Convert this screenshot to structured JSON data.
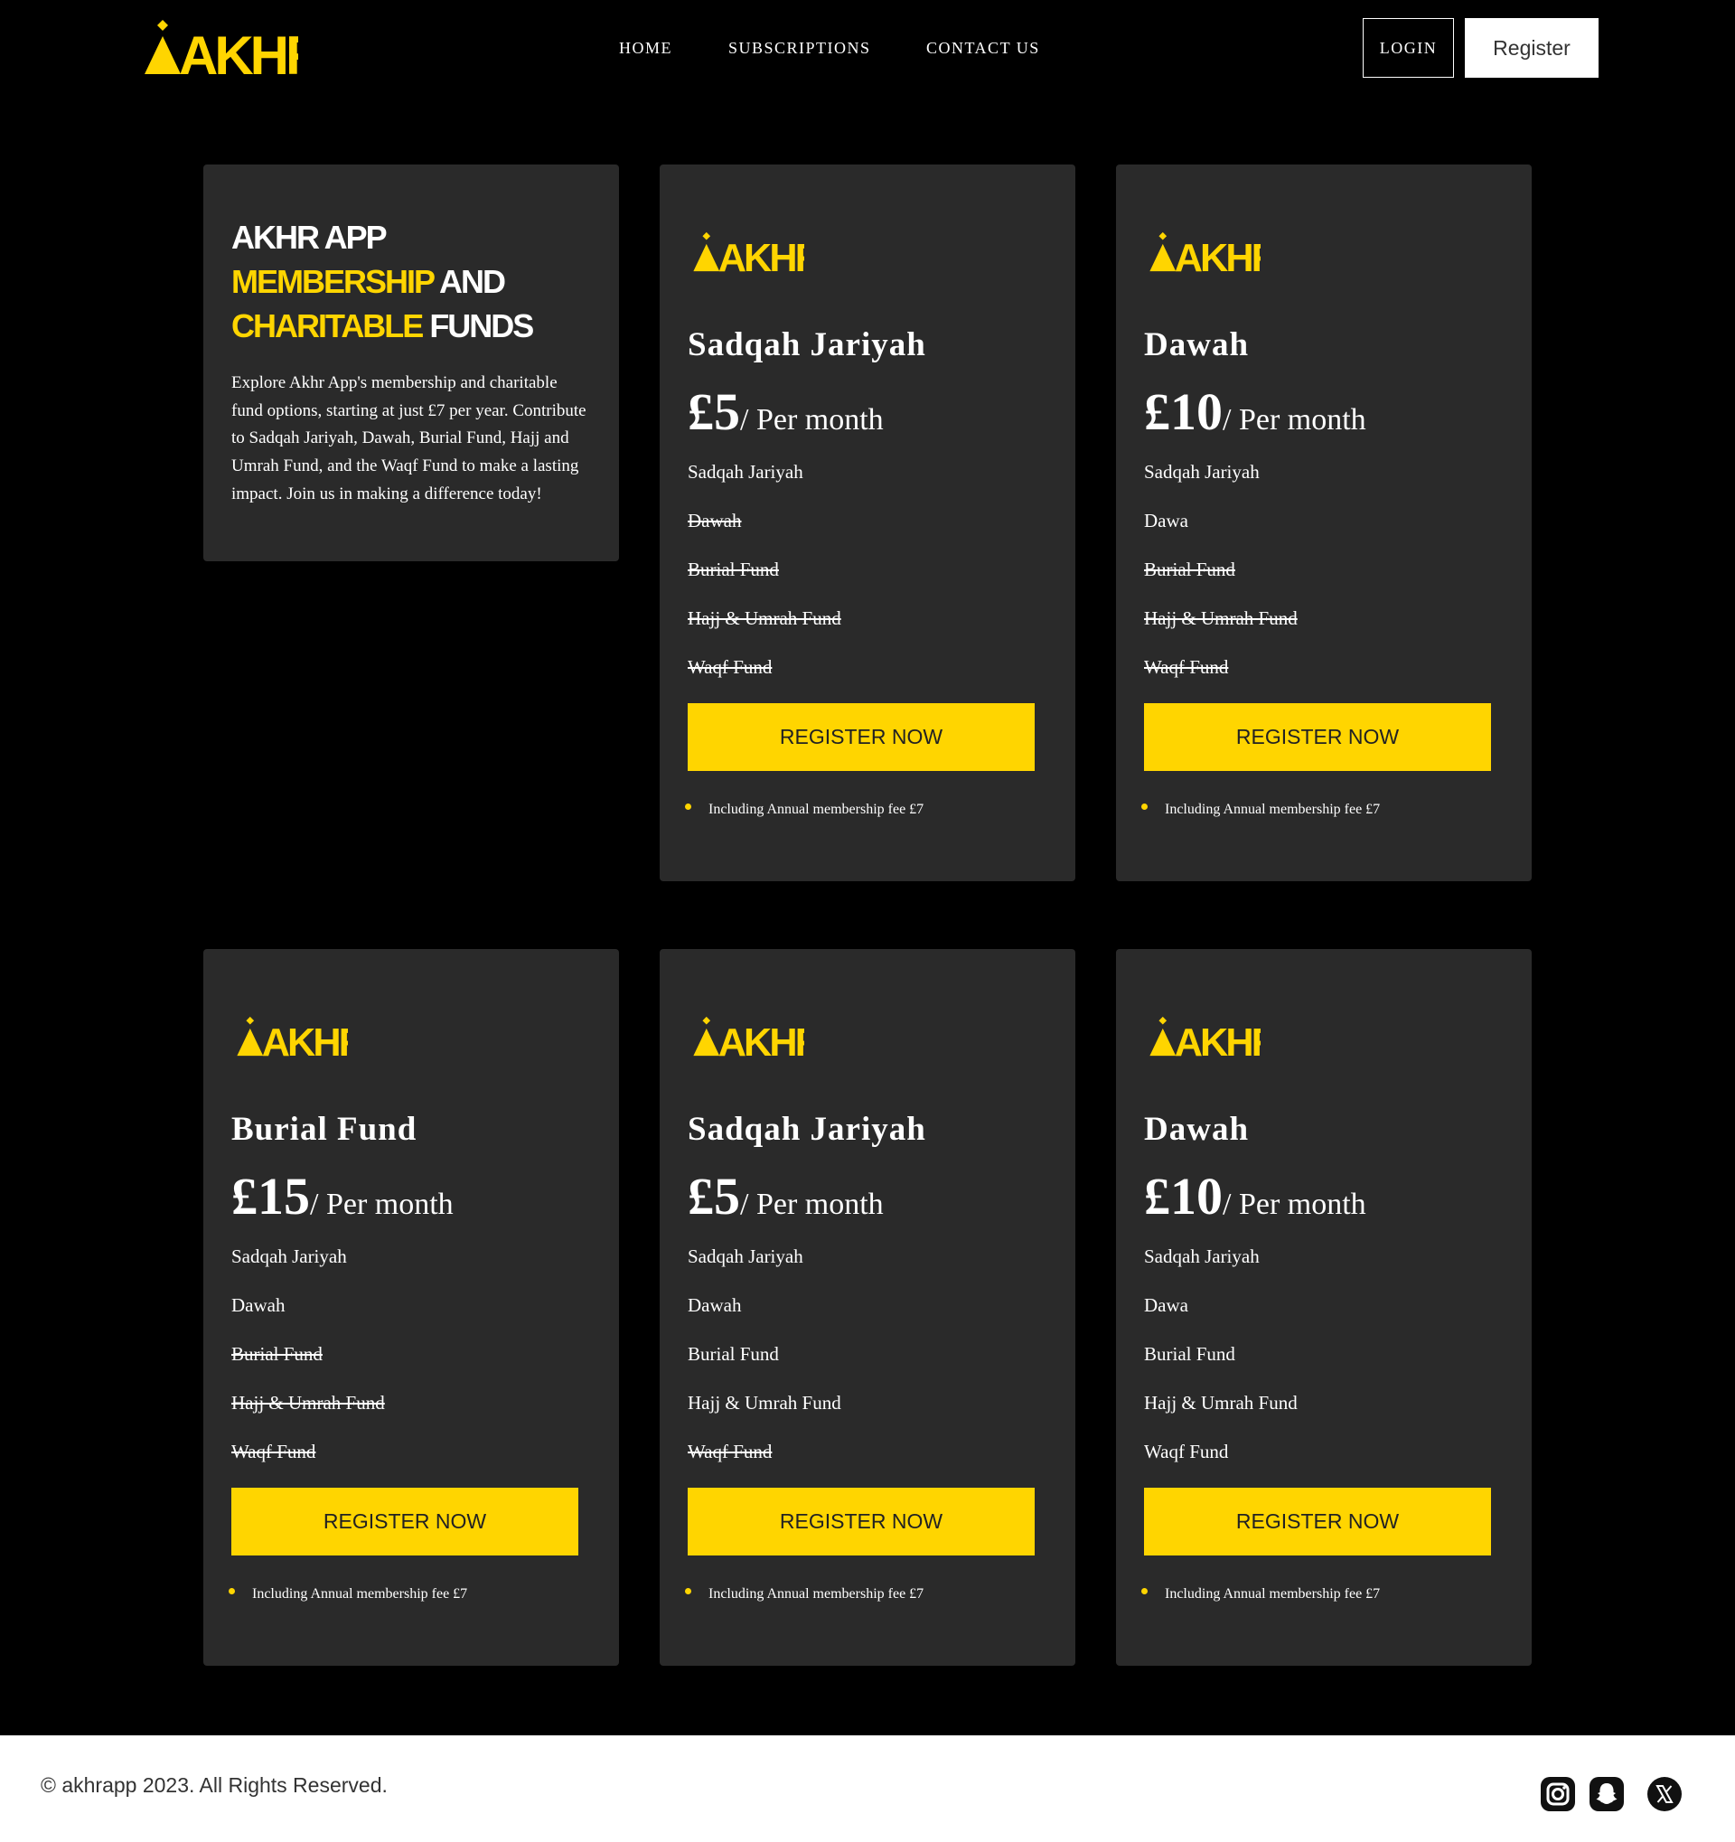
{
  "brand": {
    "logo_text": "AKHR",
    "accent_color": "#ffd500",
    "logo_icon": "akhr-logo"
  },
  "nav": {
    "items": [
      {
        "label": "HOME"
      },
      {
        "label": "SUBSCRIPTIONS"
      },
      {
        "label": "CONTACT US"
      }
    ],
    "login_label": "LOGIN",
    "register_label": "Register"
  },
  "intro": {
    "title_line1": "AKHR APP",
    "title_line2_highlight": "MEMBERSHIP",
    "title_line2_rest": " AND",
    "title_line3_highlight": "CHARITABLE",
    "title_line3_rest": " FUNDS",
    "text": "Explore Akhr App's membership and charitable fund options, starting at just £7 per year. Contribute to Sadqah Jariyah, Dawah, Burial Fund, Hajj and Umrah Fund, and the Waqf Fund to make a lasting impact. Join us in making a difference today!"
  },
  "plans": [
    {
      "name": "Sadqah Jariyah",
      "price": "£5",
      "period": "/ Per month",
      "features": [
        {
          "label": "Sadqah Jariyah",
          "included": true
        },
        {
          "label": "Dawah",
          "included": false
        },
        {
          "label": "Burial Fund",
          "included": false
        },
        {
          "label": "Hajj & Umrah Fund",
          "included": false
        },
        {
          "label": "Waqf Fund",
          "included": false
        }
      ],
      "cta": "REGISTER NOW",
      "note": "Including Annual membership fee £7"
    },
    {
      "name": "Dawah",
      "price": "£10",
      "period": "/ Per month",
      "features": [
        {
          "label": "Sadqah Jariyah",
          "included": true
        },
        {
          "label": "Dawa",
          "included": true
        },
        {
          "label": "Burial Fund",
          "included": false
        },
        {
          "label": "Hajj & Umrah Fund",
          "included": false
        },
        {
          "label": "Waqf Fund",
          "included": false
        }
      ],
      "cta": "REGISTER NOW",
      "note": "Including Annual membership fee £7"
    },
    {
      "name": "Burial Fund",
      "price": "£15",
      "period": "/ Per month",
      "features": [
        {
          "label": "Sadqah Jariyah",
          "included": true
        },
        {
          "label": "Dawah",
          "included": true
        },
        {
          "label": "Burial Fund",
          "included": false
        },
        {
          "label": "Hajj & Umrah Fund",
          "included": false
        },
        {
          "label": "Waqf Fund",
          "included": false
        }
      ],
      "cta": "REGISTER NOW",
      "note": "Including Annual membership fee £7"
    },
    {
      "name": "Sadqah Jariyah",
      "price": "£5",
      "period": "/ Per month",
      "features": [
        {
          "label": "Sadqah Jariyah",
          "included": true
        },
        {
          "label": "Dawah",
          "included": true
        },
        {
          "label": "Burial Fund",
          "included": true
        },
        {
          "label": "Hajj & Umrah Fund",
          "included": true
        },
        {
          "label": "Waqf Fund",
          "included": false
        }
      ],
      "cta": "REGISTER NOW",
      "note": "Including Annual membership fee £7"
    },
    {
      "name": "Dawah",
      "price": "£10",
      "period": "/ Per month",
      "features": [
        {
          "label": "Sadqah Jariyah",
          "included": true
        },
        {
          "label": "Dawa",
          "included": true
        },
        {
          "label": "Burial Fund",
          "included": true
        },
        {
          "label": "Hajj & Umrah Fund",
          "included": true
        },
        {
          "label": "Waqf Fund",
          "included": true
        }
      ],
      "cta": "REGISTER NOW",
      "note": "Including Annual membership fee £7"
    }
  ],
  "footer": {
    "copyright": "© akhrapp 2023. All Rights Reserved.",
    "social": [
      {
        "icon": "instagram-icon"
      },
      {
        "icon": "snapchat-icon"
      },
      {
        "icon": "x-twitter-icon"
      }
    ]
  }
}
